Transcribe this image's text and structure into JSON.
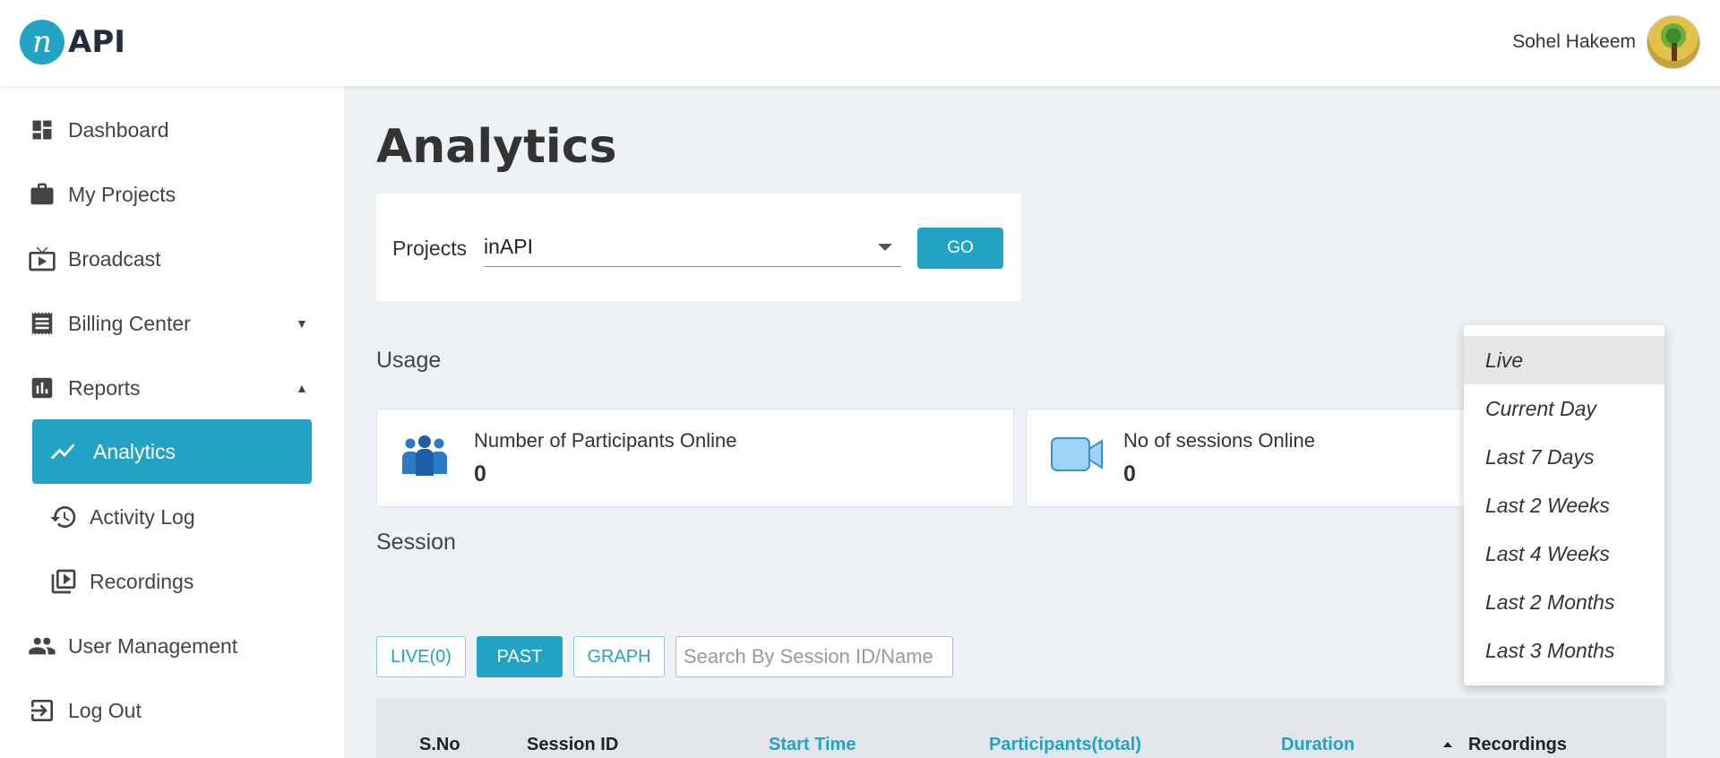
{
  "header": {
    "logo_letter": "n",
    "logo_text": "API",
    "user_name": "Sohel Hakeem"
  },
  "sidebar": {
    "items": [
      {
        "label": "Dashboard",
        "icon": "dashboard-icon"
      },
      {
        "label": "My Projects",
        "icon": "briefcase-icon"
      },
      {
        "label": "Broadcast",
        "icon": "tv-icon"
      },
      {
        "label": "Billing Center",
        "icon": "receipt-icon"
      },
      {
        "label": "Reports",
        "icon": "bar-chart-icon"
      },
      {
        "label": "Analytics",
        "icon": "trending-up-icon"
      },
      {
        "label": "Activity Log",
        "icon": "history-icon"
      },
      {
        "label": "Recordings",
        "icon": "video-library-icon"
      },
      {
        "label": "User Management",
        "icon": "people-icon"
      },
      {
        "label": "Log Out",
        "icon": "logout-icon"
      }
    ]
  },
  "main": {
    "title": "Analytics",
    "projects_label": "Projects",
    "project_value": "inAPI",
    "go_label": "GO",
    "usage_title": "Usage",
    "stats": [
      {
        "label": "Number of Participants Online",
        "value": "0",
        "icon": "participants-icon"
      },
      {
        "label": "No of sessions Online",
        "value": "0",
        "icon": "video-camera-icon"
      }
    ],
    "session_title": "Session",
    "tabs": [
      "LIVE(0)",
      "PAST",
      "GRAPH"
    ],
    "active_tab": "PAST",
    "search_placeholder": "Search By Session ID/Name",
    "table_columns": [
      "S.No",
      "Session ID",
      "Start Time",
      "Participants(total)",
      "Duration",
      "Recordings"
    ]
  },
  "dropdown": {
    "options": [
      "Live",
      "Current Day",
      "Last 7 Days",
      "Last 2 Weeks",
      "Last 4 Weeks",
      "Last 2 Months",
      "Last 3 Months"
    ],
    "highlighted": "Live"
  },
  "colors": {
    "accent": "#22a3c6",
    "background": "#eef2f6"
  }
}
